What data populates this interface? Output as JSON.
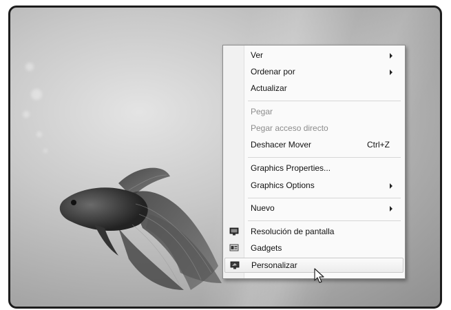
{
  "context_menu": {
    "items": [
      {
        "label": "Ver",
        "submenu": true
      },
      {
        "label": "Ordenar por",
        "submenu": true
      },
      {
        "label": "Actualizar"
      },
      {
        "label": "Pegar",
        "disabled": true
      },
      {
        "label": "Pegar acceso directo",
        "disabled": true
      },
      {
        "label": "Deshacer Mover",
        "shortcut": "Ctrl+Z"
      },
      {
        "label": "Graphics Properties..."
      },
      {
        "label": "Graphics Options",
        "submenu": true
      },
      {
        "label": "Nuevo",
        "submenu": true
      },
      {
        "label": "Resolución de pantalla",
        "icon": "display-resolution-icon"
      },
      {
        "label": "Gadgets",
        "icon": "gadgets-icon"
      },
      {
        "label": "Personalizar",
        "icon": "personalize-icon",
        "highlighted": true
      }
    ]
  },
  "desktop": {
    "wallpaper": "betta-fish",
    "icons": [
      "fish-wallpaper",
      "mouse-pointer-icon"
    ]
  }
}
